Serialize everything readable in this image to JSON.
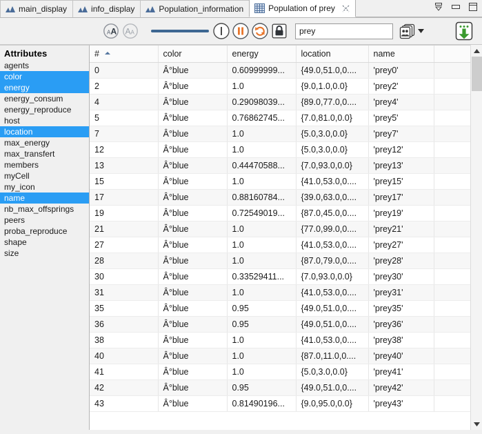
{
  "window": {
    "controls": [
      {
        "name": "minimize-control",
        "icon": "minimize-icon"
      },
      {
        "name": "restore-control",
        "icon": "restore-icon"
      },
      {
        "name": "maximize-control",
        "icon": "maximize-icon"
      }
    ]
  },
  "tabs": [
    {
      "label": "main_display",
      "icon": "chart-icon",
      "active": false,
      "closable": false
    },
    {
      "label": "info_display",
      "icon": "chart-icon",
      "active": false,
      "closable": false
    },
    {
      "label": "Population_information",
      "icon": "chart-icon",
      "active": false,
      "closable": false
    },
    {
      "label": "Population of prey",
      "icon": "table-grid-icon",
      "active": true,
      "closable": true
    }
  ],
  "toolbar": {
    "font_increase_label": "A",
    "font_decrease_label": "A",
    "slider_value": 100,
    "search": {
      "value": "prey",
      "placeholder": ""
    },
    "buttons": [
      {
        "name": "font-increase-button",
        "icon": "font-increase-icon"
      },
      {
        "name": "font-decrease-button",
        "icon": "font-decrease-icon"
      },
      {
        "name": "step-button",
        "icon": "step-icon"
      },
      {
        "name": "pause-button",
        "icon": "pause-icon"
      },
      {
        "name": "refresh-button",
        "icon": "refresh-icon"
      },
      {
        "name": "lock-button",
        "icon": "lock-icon"
      },
      {
        "name": "agents-menu-button",
        "icon": "agents-icon"
      },
      {
        "name": "export-button",
        "icon": "export-download-icon"
      }
    ]
  },
  "sidebar": {
    "title": "Attributes",
    "items": [
      {
        "label": "agents",
        "selected": false
      },
      {
        "label": "color",
        "selected": true
      },
      {
        "label": "energy",
        "selected": true
      },
      {
        "label": "energy_consum",
        "selected": false
      },
      {
        "label": "energy_reproduce",
        "selected": false
      },
      {
        "label": "host",
        "selected": false
      },
      {
        "label": "location",
        "selected": true
      },
      {
        "label": "max_energy",
        "selected": false
      },
      {
        "label": "max_transfert",
        "selected": false
      },
      {
        "label": "members",
        "selected": false
      },
      {
        "label": "myCell",
        "selected": false
      },
      {
        "label": "my_icon",
        "selected": false
      },
      {
        "label": "name",
        "selected": true
      },
      {
        "label": "nb_max_offsprings",
        "selected": false
      },
      {
        "label": "peers",
        "selected": false
      },
      {
        "label": "proba_reproduce",
        "selected": false
      },
      {
        "label": "shape",
        "selected": false
      },
      {
        "label": "size",
        "selected": false
      }
    ]
  },
  "table": {
    "columns": [
      "#",
      "color",
      "energy",
      "location",
      "name",
      ""
    ],
    "sorted_column": "#",
    "sort_direction": "ascending",
    "rows": [
      {
        "index": "0",
        "color": "Â°blue",
        "energy": "0.60999999...",
        "location": "{49.0,51.0,0....",
        "name": "'prey0'"
      },
      {
        "index": "2",
        "color": "Â°blue",
        "energy": "1.0",
        "location": "{9.0,1.0,0.0}",
        "name": "'prey2'"
      },
      {
        "index": "4",
        "color": "Â°blue",
        "energy": "0.29098039...",
        "location": "{89.0,77.0,0....",
        "name": "'prey4'"
      },
      {
        "index": "5",
        "color": "Â°blue",
        "energy": "0.76862745...",
        "location": "{7.0,81.0,0.0}",
        "name": "'prey5'"
      },
      {
        "index": "7",
        "color": "Â°blue",
        "energy": "1.0",
        "location": "{5.0,3.0,0.0}",
        "name": "'prey7'"
      },
      {
        "index": "12",
        "color": "Â°blue",
        "energy": "1.0",
        "location": "{5.0,3.0,0.0}",
        "name": "'prey12'"
      },
      {
        "index": "13",
        "color": "Â°blue",
        "energy": "0.44470588...",
        "location": "{7.0,93.0,0.0}",
        "name": "'prey13'"
      },
      {
        "index": "15",
        "color": "Â°blue",
        "energy": "1.0",
        "location": "{41.0,53.0,0....",
        "name": "'prey15'"
      },
      {
        "index": "17",
        "color": "Â°blue",
        "energy": "0.88160784...",
        "location": "{39.0,63.0,0....",
        "name": "'prey17'"
      },
      {
        "index": "19",
        "color": "Â°blue",
        "energy": "0.72549019...",
        "location": "{87.0,45.0,0....",
        "name": "'prey19'"
      },
      {
        "index": "21",
        "color": "Â°blue",
        "energy": "1.0",
        "location": "{77.0,99.0,0....",
        "name": "'prey21'"
      },
      {
        "index": "27",
        "color": "Â°blue",
        "energy": "1.0",
        "location": "{41.0,53.0,0....",
        "name": "'prey27'"
      },
      {
        "index": "28",
        "color": "Â°blue",
        "energy": "1.0",
        "location": "{87.0,79.0,0....",
        "name": "'prey28'"
      },
      {
        "index": "30",
        "color": "Â°blue",
        "energy": "0.33529411...",
        "location": "{7.0,93.0,0.0}",
        "name": "'prey30'"
      },
      {
        "index": "31",
        "color": "Â°blue",
        "energy": "1.0",
        "location": "{41.0,53.0,0....",
        "name": "'prey31'"
      },
      {
        "index": "35",
        "color": "Â°blue",
        "energy": "0.95",
        "location": "{49.0,51.0,0....",
        "name": "'prey35'"
      },
      {
        "index": "36",
        "color": "Â°blue",
        "energy": "0.95",
        "location": "{49.0,51.0,0....",
        "name": "'prey36'"
      },
      {
        "index": "38",
        "color": "Â°blue",
        "energy": "1.0",
        "location": "{41.0,53.0,0....",
        "name": "'prey38'"
      },
      {
        "index": "40",
        "color": "Â°blue",
        "energy": "1.0",
        "location": "{87.0,11.0,0....",
        "name": "'prey40'"
      },
      {
        "index": "41",
        "color": "Â°blue",
        "energy": "1.0",
        "location": "{5.0,3.0,0.0}",
        "name": "'prey41'"
      },
      {
        "index": "42",
        "color": "Â°blue",
        "energy": "0.95",
        "location": "{49.0,51.0,0....",
        "name": "'prey42'"
      },
      {
        "index": "43",
        "color": "Â°blue",
        "energy": "0.81490196...",
        "location": "{9.0,95.0,0.0}",
        "name": "'prey43'"
      }
    ]
  },
  "colors": {
    "selection": "#2a9df4",
    "slider": "#3d6792",
    "accent_orange": "#e8762c",
    "accent_green": "#3a9a2e",
    "tab_icon": "#4a6c99"
  }
}
